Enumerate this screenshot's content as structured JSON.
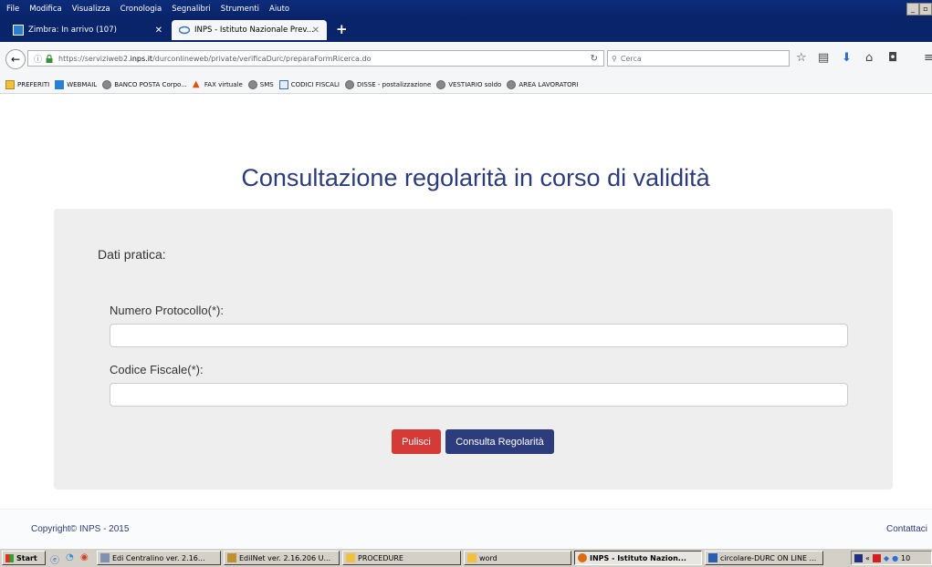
{
  "browser": {
    "menu": [
      "File",
      "Modifica",
      "Visualizza",
      "Cronologia",
      "Segnalibri",
      "Strumenti",
      "Aiuto"
    ],
    "tabs": [
      {
        "label": "Zimbra: In arrivo (107)",
        "active": false
      },
      {
        "label": "INPS - Istituto Nazionale Prev...",
        "active": true
      }
    ],
    "new_tab_label": "+",
    "url_prefix": "https://serviziweb2.",
    "url_domain": "inps.it",
    "url_path": "/durconlineweb/private/verificaDurc/preparaFormRicerca.do",
    "search_placeholder": "Cerca",
    "bookmarks": [
      "PREFERITI",
      "WEBMAIL",
      "BANCO POSTA Corpo...",
      "FAX virtuale",
      "SMS",
      "CODICI FISCALI",
      "DISSE - postalizzazione",
      "VESTIARIO soldo",
      "AREA LAVORATORI"
    ]
  },
  "page": {
    "title": "Consultazione regolarità in corso di validità",
    "section_label": "Dati pratica:",
    "fields": [
      {
        "label": "Numero Protocollo(*):",
        "value": ""
      },
      {
        "label": "Codice Fiscale(*):",
        "value": ""
      }
    ],
    "buttons": {
      "clear": "Pulisci",
      "check": "Consulta Regolarità"
    },
    "footer": {
      "copyright": "Copyright© INPS - 2015",
      "contact": "Contattaci"
    },
    "colors": {
      "brand_blue": "#2c3c7c",
      "clear_red": "#d53a36",
      "panel_gray": "#eeeeee"
    }
  },
  "taskbar": {
    "start": "Start",
    "tasks": [
      {
        "label": "Edi Centralino  ver. 2.16...",
        "pressed": false
      },
      {
        "label": "EdilNet  ver. 2.16.206 U...",
        "pressed": false
      },
      {
        "label": "PROCEDURE",
        "pressed": false
      },
      {
        "label": "word",
        "pressed": false
      },
      {
        "label": "INPS - Istituto Nazion...",
        "pressed": true
      },
      {
        "label": "circolare-DURC ON LINE ...",
        "pressed": false
      }
    ],
    "clock_fragment": "10"
  }
}
